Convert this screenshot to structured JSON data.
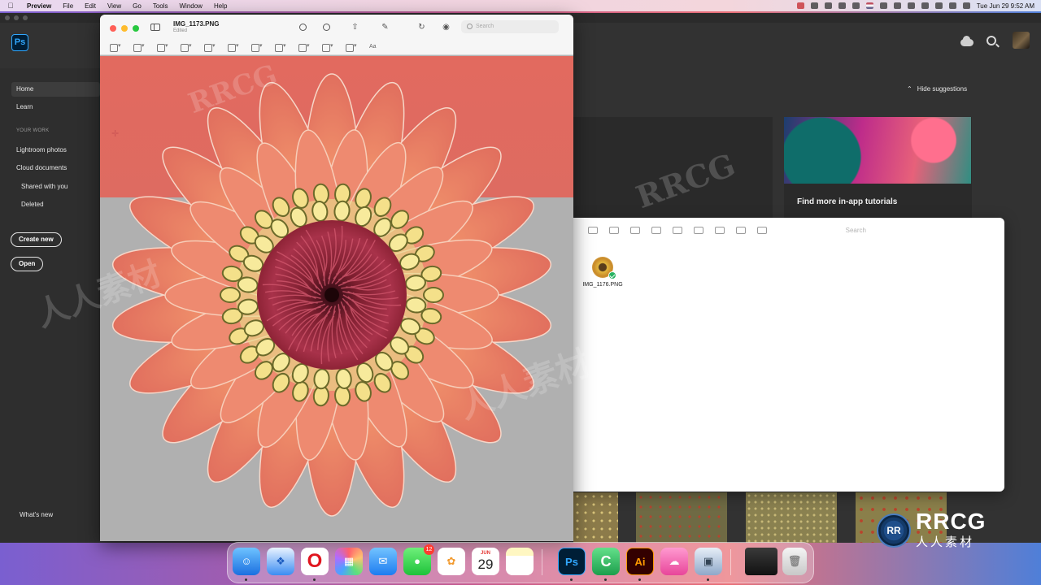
{
  "menubar": {
    "app_name": "Preview",
    "menus": [
      "File",
      "Edit",
      "View",
      "Go",
      "Tools",
      "Window",
      "Help"
    ],
    "clock": "Tue Jun 29  9:52 AM"
  },
  "photoshop": {
    "logo": "Ps",
    "sidebar": {
      "home": "Home",
      "learn": "Learn",
      "your_work_label": "YOUR WORK",
      "lightroom": "Lightroom photos",
      "cloud_docs": "Cloud documents",
      "shared": "Shared with you",
      "deleted": "Deleted",
      "create_new": "Create new",
      "open": "Open",
      "whats_new": "What's new"
    },
    "hide_suggestions": "Hide suggestions",
    "tutorial_title": "Find more in-app tutorials"
  },
  "preview": {
    "title": "IMG_1173.PNG",
    "subtitle": "Edited",
    "search_placeholder": "Search",
    "font_menu": "Aa"
  },
  "finder": {
    "search_placeholder": "Search",
    "file_name": "IMG_1176.PNG"
  },
  "dock": {
    "messages_badge": "12",
    "calendar_month": "JUN",
    "calendar_day": "29",
    "ps_label": "Ps",
    "ai_label": "Ai"
  },
  "watermark": {
    "brand": "RRCG",
    "brand_cn": "人人素材"
  }
}
